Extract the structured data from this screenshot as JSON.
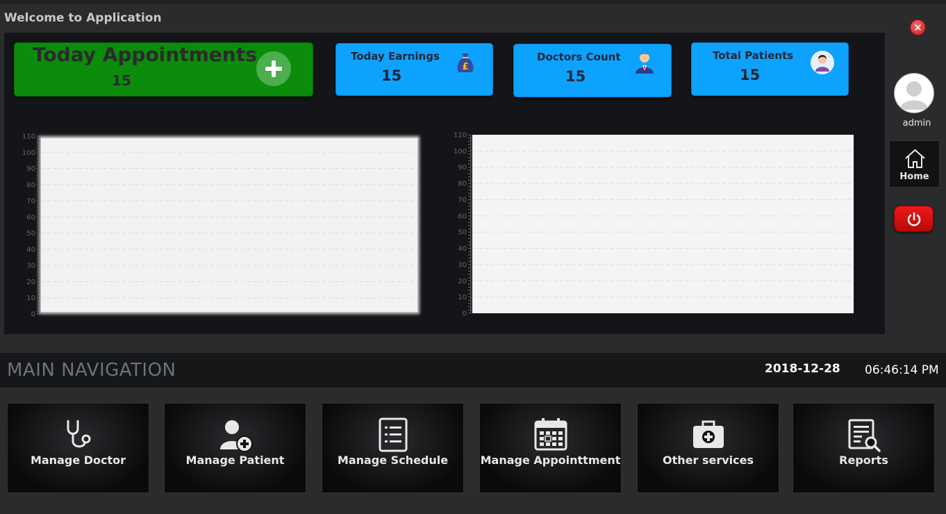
{
  "window": {
    "title": "Welcome to Application"
  },
  "cards": {
    "appointments": {
      "title": "Today Appointments",
      "value": "15"
    },
    "earnings": {
      "title": "Today Earnings",
      "value": "15"
    },
    "doctors": {
      "title": "Doctors Count",
      "value": "15"
    },
    "patients": {
      "title": "Total Patients",
      "value": "15"
    }
  },
  "user": {
    "name": "admin"
  },
  "sidebar": {
    "home_label": "Home"
  },
  "nav": {
    "title": "MAIN NAVIGATION",
    "date": "2018-12-28",
    "time": "06:46:14 PM",
    "tiles": [
      {
        "label": "Manage Doctor",
        "icon": "stethoscope-icon"
      },
      {
        "label": "Manage Patient",
        "icon": "add-user-icon"
      },
      {
        "label": "Manage Schedule",
        "icon": "list-icon"
      },
      {
        "label": "Manage Appointtment",
        "icon": "calendar-icon"
      },
      {
        "label": "Other services",
        "icon": "medical-kit-icon"
      },
      {
        "label": "Reports",
        "icon": "report-search-icon"
      }
    ]
  },
  "chart_data": [
    {
      "type": "bar",
      "categories": [],
      "values": [],
      "ylim": [
        0,
        110
      ],
      "yticks": [
        "0",
        "10",
        "20",
        "30",
        "40",
        "50",
        "60",
        "70",
        "80",
        "90",
        "100",
        "110"
      ],
      "grid": true
    },
    {
      "type": "bar",
      "categories": [],
      "values": [],
      "ylim": [
        0,
        110
      ],
      "yticks": [
        "0",
        "10",
        "20",
        "30",
        "40",
        "50",
        "60",
        "70",
        "80",
        "90",
        "100",
        "110"
      ],
      "grid": true
    }
  ],
  "colors": {
    "appointments_card": "#0b8c0b",
    "stat_card": "#0ea2ff",
    "power_button": "#d91010",
    "close_button": "#d93030"
  }
}
